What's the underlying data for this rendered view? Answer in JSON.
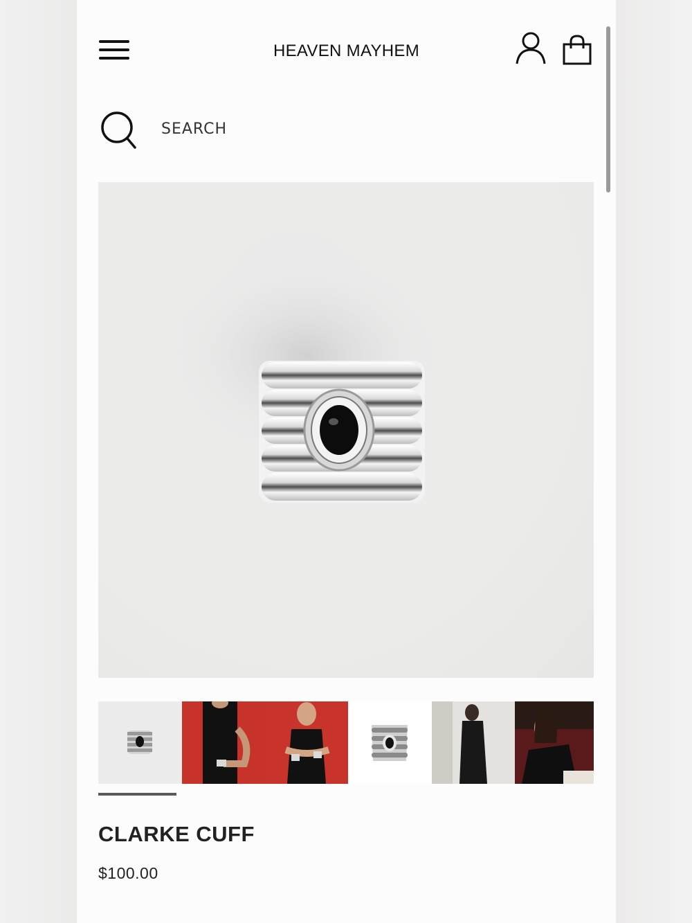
{
  "header": {
    "brand": "HEAVEN MAYHEM",
    "menu_icon": "hamburger-menu-icon",
    "account_icon": "user-account-icon",
    "bag_icon": "shopping-bag-icon"
  },
  "search": {
    "placeholder": "SEARCH",
    "value": "",
    "icon": "search-icon"
  },
  "gallery": {
    "main_image_alt": "Clarke Cuff silver ribbed cuff with black oval stone",
    "thumbnails": [
      {
        "alt": "Cuff on white background",
        "selected": true
      },
      {
        "alt": "Model wearing cuff, red background",
        "selected": false
      },
      {
        "alt": "Model wearing cuff, red background, arms crossed",
        "selected": false
      },
      {
        "alt": "Cuff product shot, front view",
        "selected": false
      },
      {
        "alt": "Model in black outfit mirror selfie",
        "selected": false
      },
      {
        "alt": "Model seated at restaurant table",
        "selected": false
      }
    ]
  },
  "product": {
    "name": "CLARKE CUFF",
    "price": "$100.00"
  },
  "colors": {
    "text": "#111111",
    "image_bg": "#eaeaea",
    "thumb_red": "#c8322a",
    "indicator": "#5a5a5a"
  }
}
